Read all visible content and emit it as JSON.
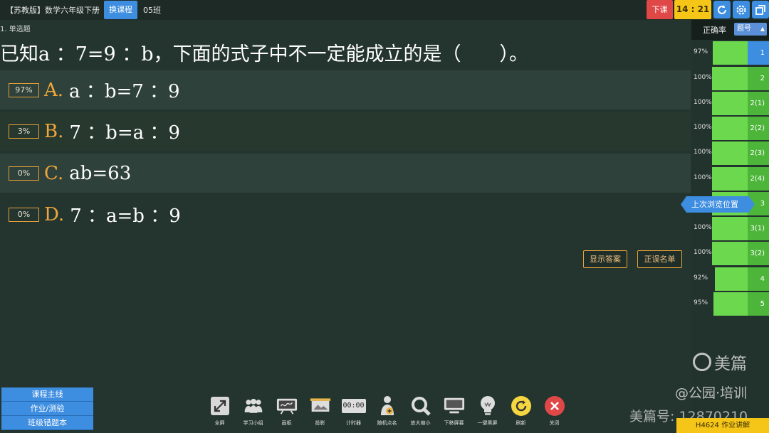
{
  "topbar": {
    "course_title": "【苏教版】数学六年级下册",
    "switch_course": "换课程",
    "class_name": "05班",
    "end_class": "下课",
    "timer": "14 : 21"
  },
  "question": {
    "type": "1.  单选题",
    "stem": "已知a ：7=9 ：b，下面的式子中不一定能成立的是（　　）。",
    "options": [
      {
        "pct": "97%",
        "letter": "A.",
        "text": "a ：b=7 ：9"
      },
      {
        "pct": "3%",
        "letter": "B.",
        "text": "7 ：b=a ：9"
      },
      {
        "pct": "0%",
        "letter": "C.",
        "text": "ab=63"
      },
      {
        "pct": "0%",
        "letter": "D.",
        "text": "7 ：a=b ：9"
      }
    ],
    "show_answer": "显示答案",
    "wrong_list": "正误名单"
  },
  "panel": {
    "rate_label": "正确率",
    "sort_label": "题号",
    "last_position": "上次浏览位置",
    "rows": [
      {
        "pct": "97%",
        "num": "1",
        "rate": 0.97
      },
      {
        "pct": "100%",
        "num": "2",
        "rate": 1.0
      },
      {
        "pct": "100%",
        "num": "2(1)",
        "rate": 1.0
      },
      {
        "pct": "100%",
        "num": "2(2)",
        "rate": 1.0
      },
      {
        "pct": "100%",
        "num": "2(3)",
        "rate": 1.0
      },
      {
        "pct": "100%",
        "num": "2(4)",
        "rate": 1.0
      },
      {
        "pct": "",
        "num": "3",
        "rate": 1.0
      },
      {
        "pct": "100%",
        "num": "3(1)",
        "rate": 1.0
      },
      {
        "pct": "100%",
        "num": "3(2)",
        "rate": 1.0
      },
      {
        "pct": "92%",
        "num": "4",
        "rate": 0.92
      },
      {
        "pct": "95%",
        "num": "5",
        "rate": 0.95
      }
    ]
  },
  "left_buttons": [
    "课程主线",
    "作业/测验",
    "班级错题本"
  ],
  "tools": [
    {
      "label": "全屏",
      "icon": "fullscreen-icon"
    },
    {
      "label": "学习小组",
      "icon": "group-icon"
    },
    {
      "label": "画板",
      "icon": "drawing-board-icon"
    },
    {
      "label": "投影",
      "icon": "projection-icon"
    },
    {
      "label": "计时器",
      "icon": "timer-icon"
    },
    {
      "label": "随机点名",
      "icon": "random-call-icon"
    },
    {
      "label": "放大缩小",
      "icon": "magnifier-icon"
    },
    {
      "label": "下移屏幕",
      "icon": "move-screen-down-icon"
    },
    {
      "label": "一键黑屏",
      "icon": "blackout-bulb-icon"
    },
    {
      "label": "刷新",
      "icon": "refresh-icon"
    },
    {
      "label": "关闭",
      "icon": "close-icon"
    }
  ],
  "timer_display": "00:00",
  "watermark": {
    "logo": "美篇",
    "line1": "@公园·培训",
    "line2": "美篇号: 12870210"
  },
  "homework_badge": "H4624 作业讲解",
  "colors": {
    "accent_blue": "#3d8de0",
    "option_orange": "#f0a63a",
    "correct_green": "#6cd84e",
    "end_red": "#e04848",
    "timer_yellow": "#f5c518"
  }
}
